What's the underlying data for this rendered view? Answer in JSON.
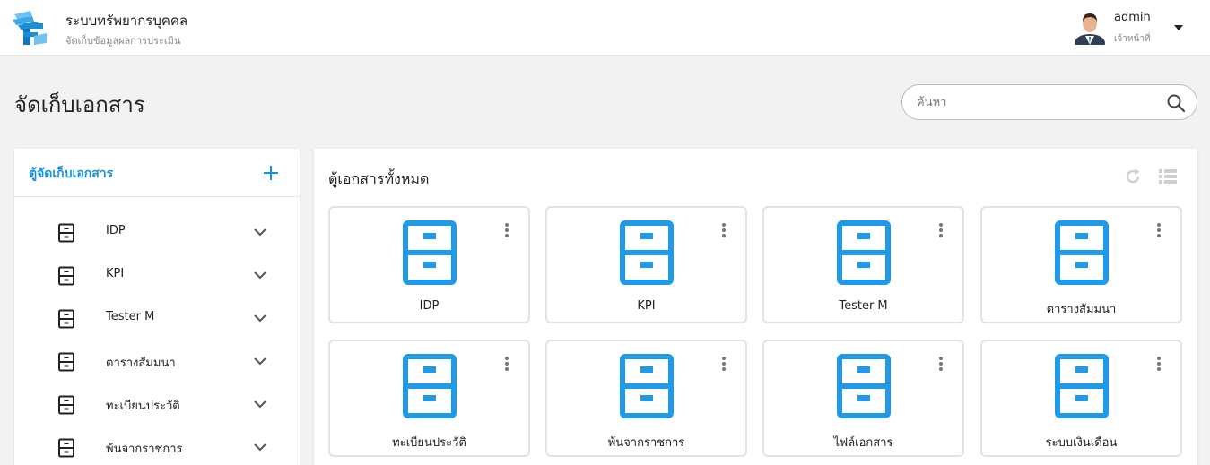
{
  "header": {
    "app_title": "ระบบทรัพยากรบุคคล",
    "app_subtitle": "จัดเก็บข้อมูลผลการประเมิน",
    "user_name": "admin",
    "user_role": "เจ้าหน้าที่"
  },
  "page": {
    "title": "จัดเก็บเอกสาร"
  },
  "search": {
    "placeholder": "ค้นหา",
    "value": ""
  },
  "sidebar": {
    "title": "ตู้จัดเก็บเอกสาร",
    "add_icon": "plus-icon",
    "items": [
      {
        "label": "IDP",
        "icon": "cabinet-icon"
      },
      {
        "label": "KPI",
        "icon": "cabinet-icon"
      },
      {
        "label": "Tester M",
        "icon": "cabinet-icon"
      },
      {
        "label": "ตารางสัมมนา",
        "icon": "cabinet-icon"
      },
      {
        "label": "ทะเบียนประวัติ",
        "icon": "cabinet-icon"
      },
      {
        "label": "พ้นจากราชการ",
        "icon": "cabinet-icon"
      }
    ]
  },
  "main": {
    "title": "ตู้เอกสารทั้งหมด",
    "cabinets": [
      {
        "name": "IDP"
      },
      {
        "name": "KPI"
      },
      {
        "name": "Tester M"
      },
      {
        "name": "ตารางสัมมนา"
      },
      {
        "name": "ทะเบียนประวัติ"
      },
      {
        "name": "พ้นจากราชการ"
      },
      {
        "name": "ไฟล์เอกสาร"
      },
      {
        "name": "ระบบเงินเดือน"
      }
    ]
  },
  "colors": {
    "accent": "#1a8fd6",
    "cabinet": "#1e9ae8",
    "border": "#e2e2e2"
  }
}
